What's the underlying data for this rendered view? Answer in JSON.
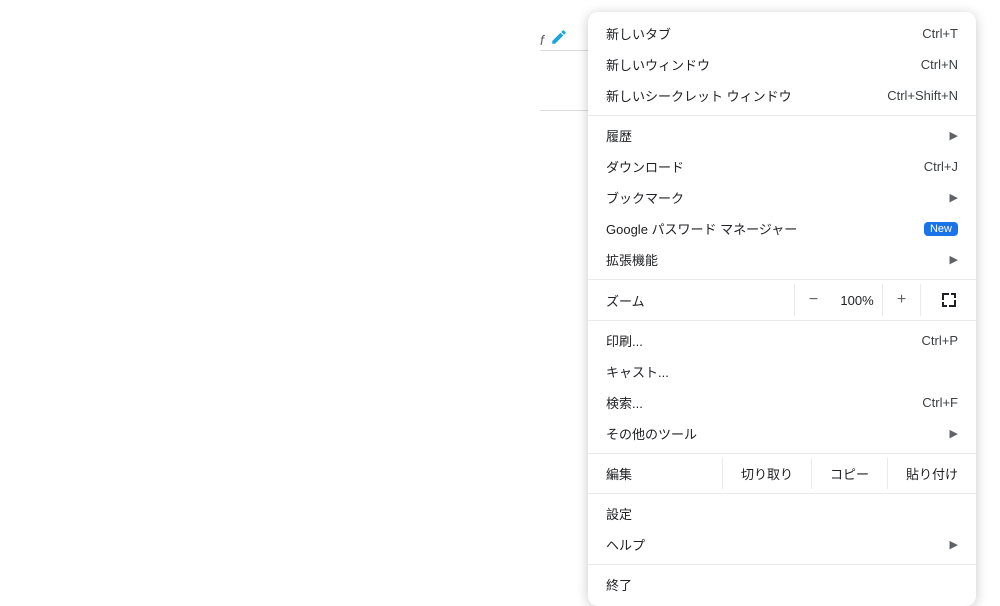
{
  "background": {
    "italic_letter": "f"
  },
  "menu": {
    "items": {
      "new_tab": {
        "label": "新しいタブ",
        "shortcut": "Ctrl+T"
      },
      "new_window": {
        "label": "新しいウィンドウ",
        "shortcut": "Ctrl+N"
      },
      "new_incognito": {
        "label": "新しいシークレット ウィンドウ",
        "shortcut": "Ctrl+Shift+N"
      },
      "history": {
        "label": "履歴"
      },
      "downloads": {
        "label": "ダウンロード",
        "shortcut": "Ctrl+J"
      },
      "bookmarks": {
        "label": "ブックマーク"
      },
      "password_manager": {
        "label": "Google パスワード マネージャー",
        "badge": "New"
      },
      "extensions": {
        "label": "拡張機能"
      },
      "zoom": {
        "label": "ズーム",
        "value": "100%"
      },
      "print": {
        "label": "印刷...",
        "shortcut": "Ctrl+P"
      },
      "cast": {
        "label": "キャスト..."
      },
      "find": {
        "label": "検索...",
        "shortcut": "Ctrl+F"
      },
      "more_tools": {
        "label": "その他のツール"
      },
      "edit": {
        "label": "編集",
        "cut": "切り取り",
        "copy": "コピー",
        "paste": "貼り付け"
      },
      "settings": {
        "label": "設定"
      },
      "help": {
        "label": "ヘルプ"
      },
      "exit": {
        "label": "終了"
      }
    }
  }
}
